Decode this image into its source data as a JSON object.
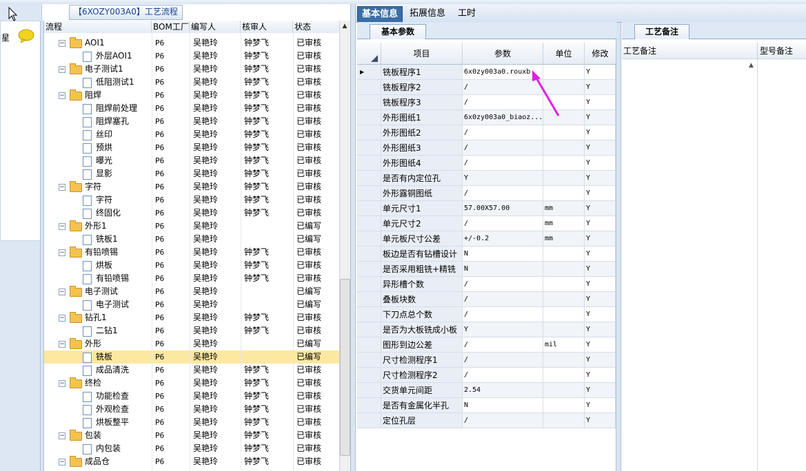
{
  "tree": {
    "title": "【6XOZY003A0】工艺流程",
    "headers": {
      "flow": "流程",
      "bom": "BOM工厂",
      "author": "编写人",
      "reviewer": "核审人",
      "status": "状态"
    },
    "rows": [
      {
        "name": "AOI1",
        "level": 0,
        "bom": "P6",
        "author": "吴艳玲",
        "reviewer": "钟梦飞",
        "status": "已审核"
      },
      {
        "name": "外层AOI1",
        "level": 1,
        "bom": "P6",
        "author": "吴艳玲",
        "reviewer": "钟梦飞",
        "status": "已审核"
      },
      {
        "name": "电子测试1",
        "level": 0,
        "bom": "P6",
        "author": "吴艳玲",
        "reviewer": "钟梦飞",
        "status": "已审核"
      },
      {
        "name": "低阻测试1",
        "level": 1,
        "bom": "P6",
        "author": "吴艳玲",
        "reviewer": "钟梦飞",
        "status": "已审核"
      },
      {
        "name": "阻焊",
        "level": 0,
        "bom": "P6",
        "author": "吴艳玲",
        "reviewer": "钟梦飞",
        "status": "已审核"
      },
      {
        "name": "阻焊前处理",
        "level": 1,
        "bom": "P6",
        "author": "吴艳玲",
        "reviewer": "钟梦飞",
        "status": "已审核"
      },
      {
        "name": "阻焊塞孔",
        "level": 1,
        "bom": "P6",
        "author": "吴艳玲",
        "reviewer": "钟梦飞",
        "status": "已审核"
      },
      {
        "name": "丝印",
        "level": 1,
        "bom": "P6",
        "author": "吴艳玲",
        "reviewer": "钟梦飞",
        "status": "已审核"
      },
      {
        "name": "预烘",
        "level": 1,
        "bom": "P6",
        "author": "吴艳玲",
        "reviewer": "钟梦飞",
        "status": "已审核"
      },
      {
        "name": "曝光",
        "level": 1,
        "bom": "P6",
        "author": "吴艳玲",
        "reviewer": "钟梦飞",
        "status": "已审核"
      },
      {
        "name": "显影",
        "level": 1,
        "bom": "P6",
        "author": "吴艳玲",
        "reviewer": "钟梦飞",
        "status": "已审核"
      },
      {
        "name": "字符",
        "level": 0,
        "bom": "P6",
        "author": "吴艳玲",
        "reviewer": "钟梦飞",
        "status": "已审核"
      },
      {
        "name": "字符",
        "level": 1,
        "bom": "P6",
        "author": "吴艳玲",
        "reviewer": "钟梦飞",
        "status": "已审核"
      },
      {
        "name": "终固化",
        "level": 1,
        "bom": "P6",
        "author": "吴艳玲",
        "reviewer": "钟梦飞",
        "status": "已审核"
      },
      {
        "name": "外形1",
        "level": 0,
        "bom": "P6",
        "author": "吴艳玲",
        "reviewer": "",
        "status": "已编写"
      },
      {
        "name": "铣板1",
        "level": 1,
        "bom": "P6",
        "author": "吴艳玲",
        "reviewer": "",
        "status": "已编写"
      },
      {
        "name": "有铅喷锡",
        "level": 0,
        "bom": "P6",
        "author": "吴艳玲",
        "reviewer": "钟梦飞",
        "status": "已审核"
      },
      {
        "name": "烘板",
        "level": 1,
        "bom": "P6",
        "author": "吴艳玲",
        "reviewer": "钟梦飞",
        "status": "已审核"
      },
      {
        "name": "有铅喷锡",
        "level": 1,
        "bom": "P6",
        "author": "吴艳玲",
        "reviewer": "钟梦飞",
        "status": "已审核"
      },
      {
        "name": "电子测试",
        "level": 0,
        "bom": "P6",
        "author": "吴艳玲",
        "reviewer": "",
        "status": "已编写"
      },
      {
        "name": "电子测试",
        "level": 1,
        "bom": "P6",
        "author": "吴艳玲",
        "reviewer": "",
        "status": "已编写"
      },
      {
        "name": "钻孔1",
        "level": 0,
        "bom": "P6",
        "author": "吴艳玲",
        "reviewer": "钟梦飞",
        "status": "已审核"
      },
      {
        "name": "二钻1",
        "level": 1,
        "bom": "P6",
        "author": "吴艳玲",
        "reviewer": "钟梦飞",
        "status": "已审核"
      },
      {
        "name": "外形",
        "level": 0,
        "bom": "P6",
        "author": "吴艳玲",
        "reviewer": "",
        "status": "已编写"
      },
      {
        "name": "铣板",
        "level": 1,
        "bom": "P6",
        "author": "吴艳玲",
        "reviewer": "",
        "status": "已编写",
        "selected": true
      },
      {
        "name": "成品清洗",
        "level": 1,
        "bom": "P6",
        "author": "吴艳玲",
        "reviewer": "钟梦飞",
        "status": "已审核"
      },
      {
        "name": "终检",
        "level": 0,
        "bom": "P6",
        "author": "吴艳玲",
        "reviewer": "钟梦飞",
        "status": "已审核"
      },
      {
        "name": "功能检查",
        "level": 1,
        "bom": "P6",
        "author": "吴艳玲",
        "reviewer": "钟梦飞",
        "status": "已审核"
      },
      {
        "name": "外观检查",
        "level": 1,
        "bom": "P6",
        "author": "吴艳玲",
        "reviewer": "钟梦飞",
        "status": "已审核"
      },
      {
        "name": "烘板整平",
        "level": 1,
        "bom": "P6",
        "author": "吴艳玲",
        "reviewer": "钟梦飞",
        "status": "已审核"
      },
      {
        "name": "包装",
        "level": 0,
        "bom": "P6",
        "author": "吴艳玲",
        "reviewer": "钟梦飞",
        "status": "已审核"
      },
      {
        "name": "内包装",
        "level": 1,
        "bom": "P6",
        "author": "吴艳玲",
        "reviewer": "钟梦飞",
        "status": "已审核"
      },
      {
        "name": "成品仓",
        "level": 0,
        "bom": "P6",
        "author": "吴艳玲",
        "reviewer": "钟梦飞",
        "status": "已审核"
      }
    ]
  },
  "left_panel": {
    "label": "星"
  },
  "main_tabs": [
    "基本信息",
    "拓展信息",
    "工时"
  ],
  "sub_tab": "基本参数",
  "param_grid": {
    "headers": {
      "item": "项目",
      "param": "参数",
      "unit": "单位",
      "modify": "修改"
    },
    "rows": [
      {
        "item": "铣板程序1",
        "param": "6x0zy003a0.rouxb",
        "unit": "",
        "modify": "Y",
        "current": true
      },
      {
        "item": "铣板程序2",
        "param": "/",
        "unit": "",
        "modify": "Y"
      },
      {
        "item": "铣板程序3",
        "param": "/",
        "unit": "",
        "modify": "Y"
      },
      {
        "item": "外形图纸1",
        "param": "6x0zy003a0_biaoz...",
        "unit": "",
        "modify": "Y"
      },
      {
        "item": "外形图纸2",
        "param": "/",
        "unit": "",
        "modify": "Y"
      },
      {
        "item": "外形图纸3",
        "param": "/",
        "unit": "",
        "modify": "Y"
      },
      {
        "item": "外形图纸4",
        "param": "/",
        "unit": "",
        "modify": "Y"
      },
      {
        "item": "是否有内定位孔",
        "param": "Y",
        "unit": "",
        "modify": "Y"
      },
      {
        "item": "外形露铜图纸",
        "param": "/",
        "unit": "",
        "modify": "Y"
      },
      {
        "item": "单元尺寸1",
        "param": "57.00X57.00",
        "unit": "mm",
        "modify": "Y"
      },
      {
        "item": "单元尺寸2",
        "param": "/",
        "unit": "mm",
        "modify": "Y"
      },
      {
        "item": "单元板尺寸公差",
        "param": "+/-0.2",
        "unit": "mm",
        "modify": "Y"
      },
      {
        "item": "板边是否有钻槽设计",
        "param": "N",
        "unit": "",
        "modify": "Y"
      },
      {
        "item": "是否采用粗铣+精铣",
        "param": "N",
        "unit": "",
        "modify": "Y"
      },
      {
        "item": "异形槽个数",
        "param": "/",
        "unit": "",
        "modify": "Y"
      },
      {
        "item": "叠板块数",
        "param": "/",
        "unit": "",
        "modify": "Y"
      },
      {
        "item": "下刀点总个数",
        "param": "/",
        "unit": "",
        "modify": "Y"
      },
      {
        "item": "是否为大板铣成小板",
        "param": "Y",
        "unit": "",
        "modify": "Y"
      },
      {
        "item": "图形到边公差",
        "param": "/",
        "unit": "mil",
        "modify": "Y"
      },
      {
        "item": "尺寸检测程序1",
        "param": "/",
        "unit": "",
        "modify": "Y"
      },
      {
        "item": "尺寸检测程序2",
        "param": "/",
        "unit": "",
        "modify": "Y"
      },
      {
        "item": "交货单元间距",
        "param": "2.54",
        "unit": "",
        "modify": "Y"
      },
      {
        "item": "是否有金属化半孔",
        "param": "N",
        "unit": "",
        "modify": "Y"
      },
      {
        "item": "定位孔层",
        "param": "/",
        "unit": "",
        "modify": "Y"
      }
    ]
  },
  "remark_panel": {
    "tab": "工艺备注",
    "col1": "工艺备注",
    "col2": "型号备注"
  },
  "colors": {
    "accent": "#3a6ea5",
    "selection": "#fde8a1",
    "arrow": "#e020e0"
  },
  "icons": [
    "cursor-icon",
    "chat-bubble-icon",
    "folder-icon",
    "document-icon",
    "collapse-icon",
    "pointer-arrow-icon"
  ]
}
